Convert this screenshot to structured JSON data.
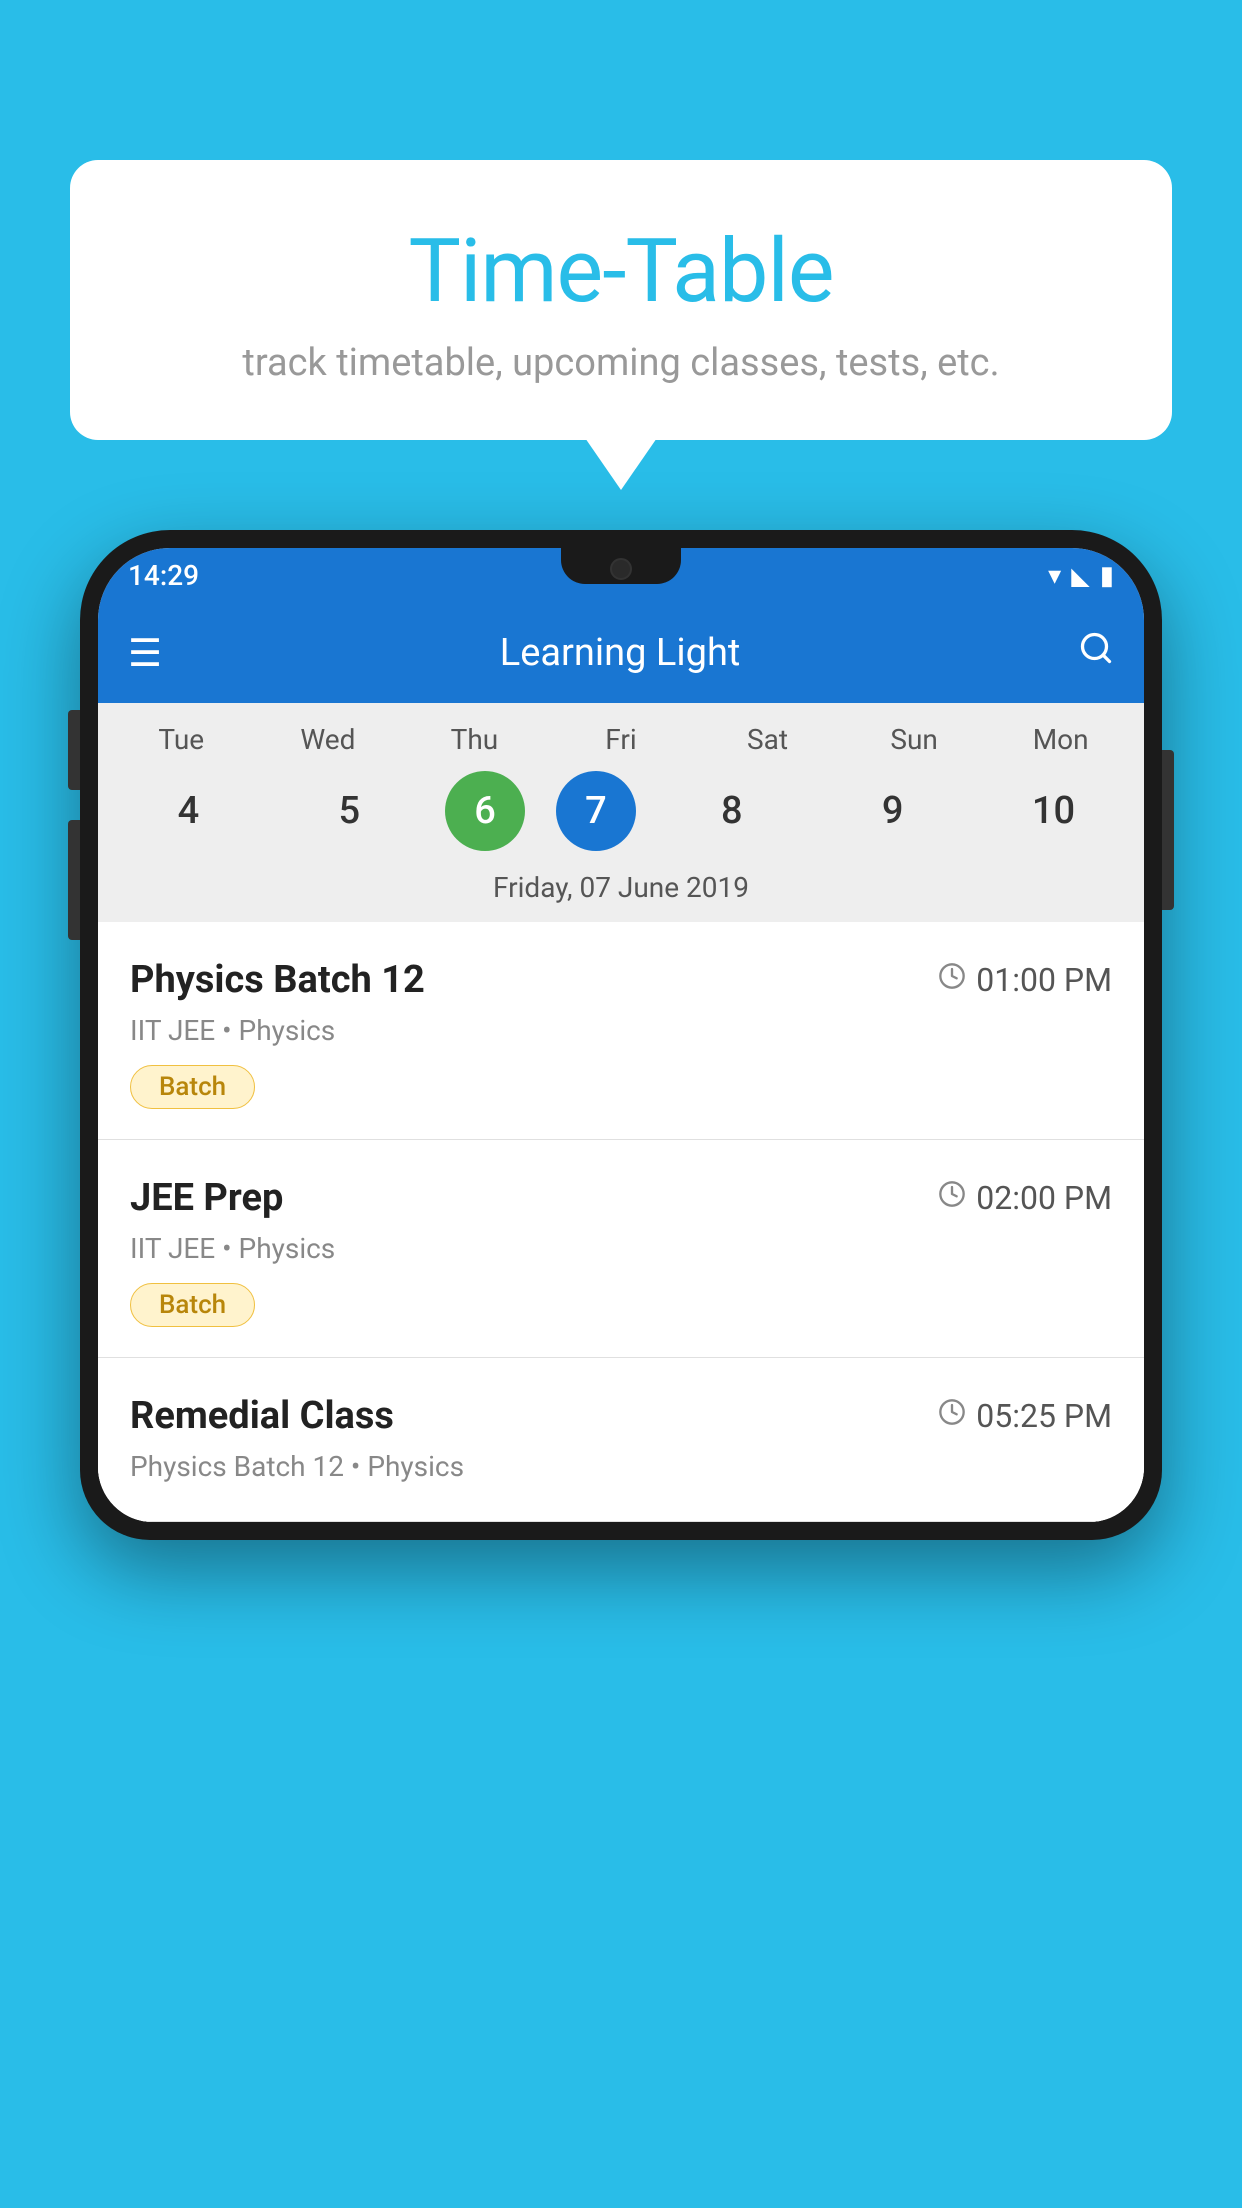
{
  "page": {
    "background_color": "#29bde8"
  },
  "speech_bubble": {
    "title": "Time-Table",
    "subtitle": "track timetable, upcoming classes, tests, etc."
  },
  "phone": {
    "status_bar": {
      "time": "14:29"
    },
    "app_bar": {
      "title": "Learning Light",
      "hamburger_label": "≡",
      "search_label": "🔍"
    },
    "calendar": {
      "days": [
        {
          "label": "Tue",
          "num": "4",
          "state": "normal"
        },
        {
          "label": "Wed",
          "num": "5",
          "state": "normal"
        },
        {
          "label": "Thu",
          "num": "6",
          "state": "today"
        },
        {
          "label": "Fri",
          "num": "7",
          "state": "selected"
        },
        {
          "label": "Sat",
          "num": "8",
          "state": "normal"
        },
        {
          "label": "Sun",
          "num": "9",
          "state": "normal"
        },
        {
          "label": "Mon",
          "num": "10",
          "state": "normal"
        }
      ],
      "selected_date_label": "Friday, 07 June 2019"
    },
    "schedule_items": [
      {
        "title": "Physics Batch 12",
        "time": "01:00 PM",
        "subtitle": "IIT JEE • Physics",
        "badge": "Batch"
      },
      {
        "title": "JEE Prep",
        "time": "02:00 PM",
        "subtitle": "IIT JEE • Physics",
        "badge": "Batch"
      },
      {
        "title": "Remedial Class",
        "time": "05:25 PM",
        "subtitle": "Physics Batch 12 • Physics",
        "badge": null
      }
    ]
  }
}
